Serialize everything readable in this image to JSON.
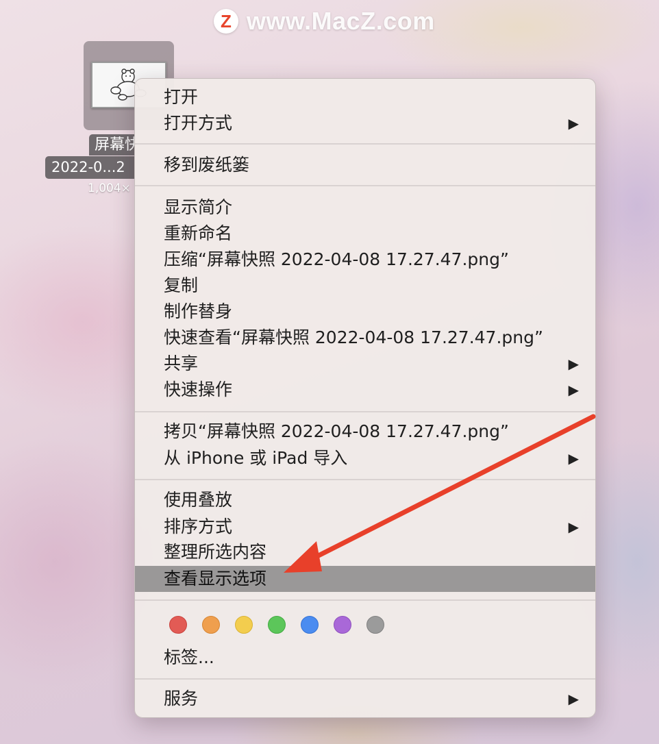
{
  "watermark": {
    "logo_letter": "Z",
    "text": "www.MacZ.com"
  },
  "desktop_file": {
    "name_line1": "屏幕快照",
    "name_line2": "2022-0...2",
    "size": "1,004×"
  },
  "context_menu": {
    "groups": [
      [
        {
          "label": "打开",
          "submenu": false
        },
        {
          "label": "打开方式",
          "submenu": true
        }
      ],
      [
        {
          "label": "移到废纸篓",
          "submenu": false
        }
      ],
      [
        {
          "label": "显示简介",
          "submenu": false
        },
        {
          "label": "重新命名",
          "submenu": false
        },
        {
          "label": "压缩“屏幕快照 2022-04-08 17.27.47.png”",
          "submenu": false
        },
        {
          "label": "复制",
          "submenu": false
        },
        {
          "label": "制作替身",
          "submenu": false
        },
        {
          "label": "快速查看“屏幕快照 2022-04-08 17.27.47.png”",
          "submenu": false
        },
        {
          "label": "共享",
          "submenu": true
        },
        {
          "label": "快速操作",
          "submenu": true
        }
      ],
      [
        {
          "label": "拷贝“屏幕快照 2022-04-08 17.27.47.png”",
          "submenu": false
        },
        {
          "label": "从 iPhone 或 iPad 导入",
          "submenu": true
        }
      ],
      [
        {
          "label": "使用叠放",
          "submenu": false
        },
        {
          "label": "排序方式",
          "submenu": true
        },
        {
          "label": "整理所选内容",
          "submenu": false
        },
        {
          "label": "查看显示选项",
          "submenu": false,
          "highlighted": true
        }
      ]
    ],
    "submenu_arrow": "▶",
    "tags": {
      "colors": [
        {
          "name": "red",
          "fill": "#e25b55",
          "stroke": "#c9433e"
        },
        {
          "name": "orange",
          "fill": "#ef9f4e",
          "stroke": "#d68634"
        },
        {
          "name": "yellow",
          "fill": "#f3cd4e",
          "stroke": "#d9b336"
        },
        {
          "name": "green",
          "fill": "#5cc65a",
          "stroke": "#44ab43"
        },
        {
          "name": "blue",
          "fill": "#4b8cf0",
          "stroke": "#3573d4"
        },
        {
          "name": "purple",
          "fill": "#a968d8",
          "stroke": "#8f51bd"
        },
        {
          "name": "gray",
          "fill": "#9b9b9b",
          "stroke": "#818181"
        }
      ],
      "label": "标签..."
    },
    "services": {
      "label": "服务",
      "submenu": true
    }
  },
  "annotation": {
    "color": "#e8402a",
    "target": "查看显示选项"
  }
}
